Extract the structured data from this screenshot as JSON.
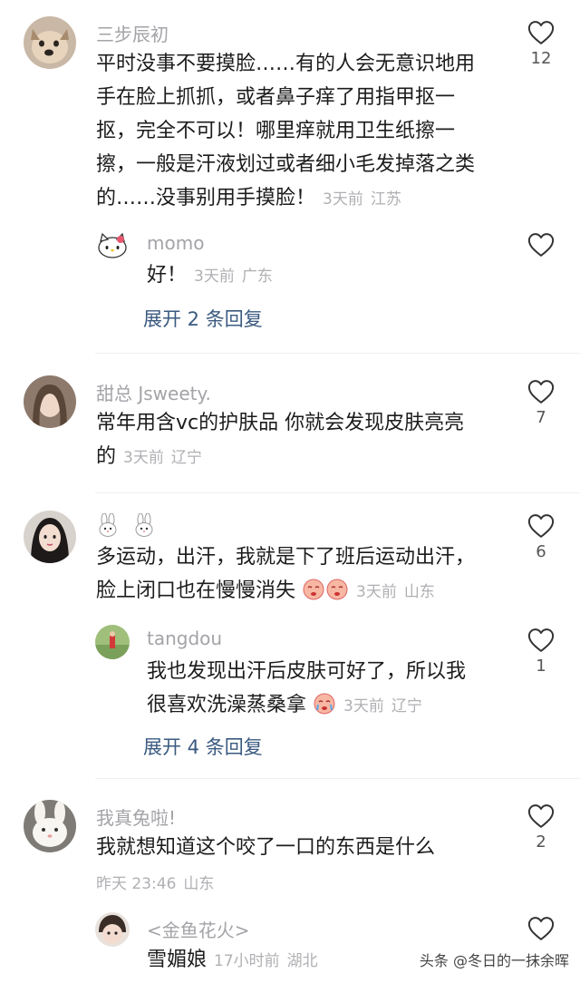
{
  "comments": [
    {
      "username": "三步辰初",
      "text": "平时没事不要摸脸……有的人会无意识地用手在脸上抓抓，或者鼻子痒了用指甲抠一抠，完全不可以！哪里痒就用卫生纸擦一擦，一般是汗液划过或者细小毛发掉落之类的……没事别用手摸脸！",
      "line1": "平时没事不要摸脸……有的人会无意识地用",
      "line2": "手在脸上抓抓，或者鼻子痒了用指甲抠一",
      "line3": "抠，完全不可以！哪里痒就用卫生纸擦一",
      "line4": "擦，一般是汗液划过或者细小毛发掉落之类",
      "line5": "的……没事别用手摸脸！",
      "time": "3天前",
      "location": "江苏",
      "likes": "12",
      "avatar_icon": "dog-avatar",
      "reply": {
        "username": "momo",
        "text": "好！",
        "time": "3天前",
        "location": "广东",
        "likes": "",
        "avatar_icon": "hello-kitty-avatar"
      },
      "expand_label": "展开 2 条回复"
    },
    {
      "username": "甜总 Jsweety.",
      "line1": "常年用含vc的护肤品 你就会发现皮肤亮亮",
      "line2": "的",
      "time": "3天前",
      "location": "辽宁",
      "likes": "7",
      "avatar_icon": "girl-avatar"
    },
    {
      "username_emoji": "bunny-emoji bunny-emoji",
      "line1": "多运动，出汗，我就是下了班后运动出汗，",
      "line2": "脸上闭口也在慢慢消失",
      "time": "3天前",
      "location": "山东",
      "likes": "6",
      "avatar_icon": "girl-avatar-2",
      "reply": {
        "username": "tangdou",
        "line1": "我也发现出汗后皮肤可好了，所以我",
        "line2": "很喜欢洗澡蒸桑拿",
        "time": "3天前",
        "location": "辽宁",
        "likes": "1",
        "avatar_icon": "outdoor-avatar"
      },
      "expand_label": "展开 4 条回复"
    },
    {
      "username": "我真兔啦!",
      "line1": "我就想知道这个咬了一口的东西是什么",
      "time": "昨天 23:46",
      "location": "山东",
      "likes": "2",
      "avatar_icon": "rabbit-avatar",
      "reply": {
        "username": "<金鱼花火>",
        "text": "雪媚娘",
        "time": "17小时前",
        "location": "湖北",
        "likes": "",
        "avatar_icon": "child-avatar"
      }
    }
  ],
  "watermark": "头条 @冬日的一抹余晖",
  "colors": {
    "name": "#a3a3a8",
    "meta": "#b0b0b4",
    "expand": "#3a5a80",
    "text": "#1c1c1c"
  }
}
